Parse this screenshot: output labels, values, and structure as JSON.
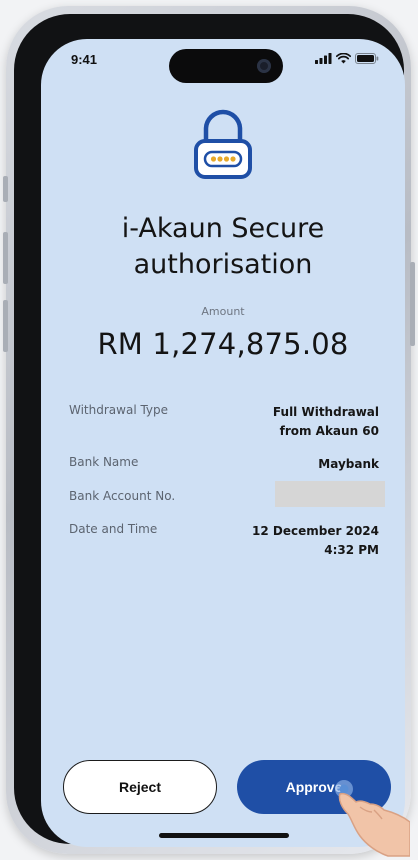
{
  "status_bar": {
    "time": "9:41"
  },
  "icons": {
    "lock": "lock-icon",
    "signal": "signal-icon",
    "wifi": "wifi-icon",
    "battery": "battery-icon",
    "hand": "pointing-hand-icon"
  },
  "header": {
    "title": "i-Akaun Secure\nauthorisation"
  },
  "amount": {
    "label": "Amount",
    "value": "RM 1,274,875.08"
  },
  "details": {
    "withdrawal_type": {
      "label": "Withdrawal Type",
      "value_line1": "Full Withdrawal",
      "value_line2": "from Akaun 60"
    },
    "bank_name": {
      "label": "Bank Name",
      "value": "Maybank"
    },
    "bank_account": {
      "label": "Bank Account  No."
    },
    "date_time": {
      "label": "Date and Time",
      "value_line1": "12 December 2024",
      "value_line2": "4:32 PM"
    }
  },
  "actions": {
    "reject_label": "Reject",
    "approve_label": "Approve"
  },
  "colors": {
    "screen_background": "#cfe0f4",
    "approve_button": "#1f4fa6",
    "lock_icon": "#1f4fa6",
    "lock_dots": "#e7a92b",
    "masked_field": "#d6d6d6"
  }
}
